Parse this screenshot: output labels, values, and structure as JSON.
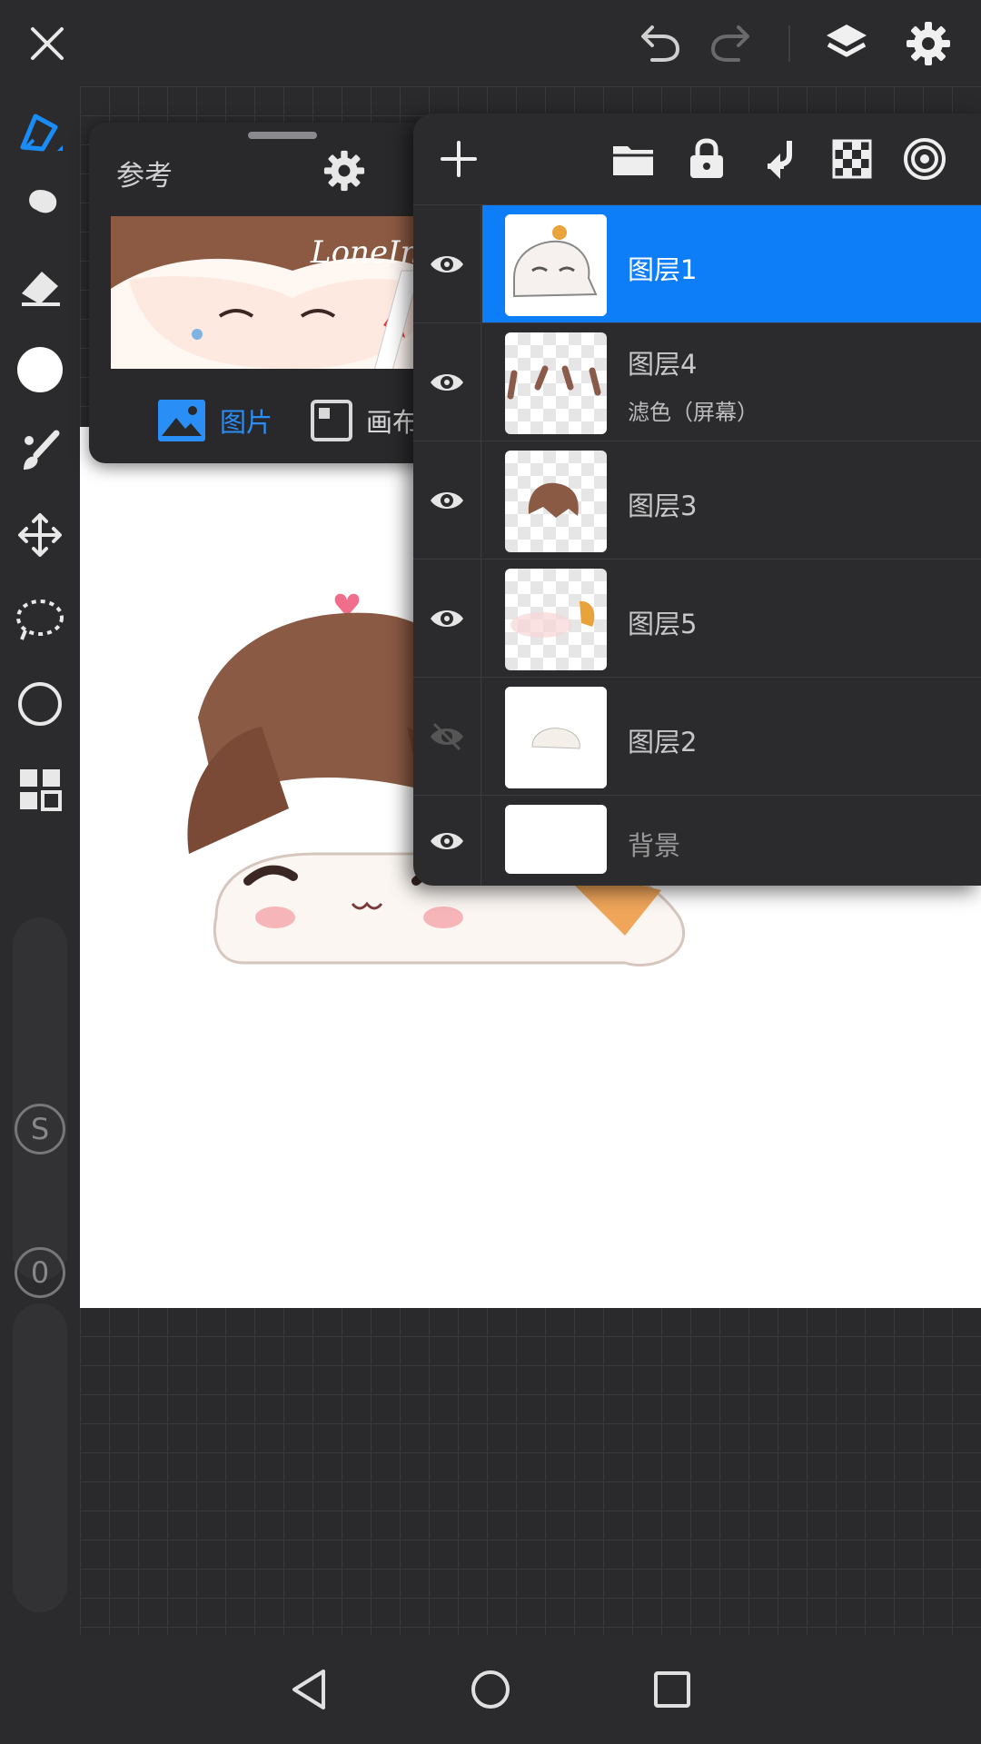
{
  "reference": {
    "title": "参考",
    "image_signature": "LoneInk",
    "tabs": [
      {
        "label": "图片",
        "active": true
      },
      {
        "label": "画布",
        "active": false
      }
    ]
  },
  "layers": {
    "items": [
      {
        "name": "图层1",
        "mode": "",
        "visible": true,
        "selected": true
      },
      {
        "name": "图层4",
        "mode": "滤色（屏幕）",
        "visible": true,
        "selected": false
      },
      {
        "name": "图层3",
        "mode": "",
        "visible": true,
        "selected": false
      },
      {
        "name": "图层5",
        "mode": "",
        "visible": true,
        "selected": false
      },
      {
        "name": "图层2",
        "mode": "",
        "visible": false,
        "selected": false
      },
      {
        "name": "背景",
        "mode": "",
        "visible": true,
        "selected": false
      }
    ]
  },
  "sidebar": {
    "stabilizer_label": "S",
    "opacity_label": "0"
  },
  "colors": {
    "accent": "#0d7ef7",
    "active_tool": "#1a8cf7",
    "panel": "#2b2b2d"
  },
  "icons": {
    "top": [
      "close-icon",
      "undo-icon",
      "redo-icon",
      "layers-icon",
      "settings-icon"
    ],
    "layer_toolbar": [
      "add-icon",
      "folder-icon",
      "lock-icon",
      "merge-down-icon",
      "checker-icon",
      "target-icon"
    ],
    "tools": [
      "pen-icon",
      "smudge-icon",
      "eraser-icon",
      "color-icon",
      "brush-icon",
      "move-icon",
      "lasso-icon",
      "shape-icon",
      "grid-icon"
    ],
    "nav": [
      "back-icon",
      "home-icon",
      "recents-icon"
    ]
  }
}
